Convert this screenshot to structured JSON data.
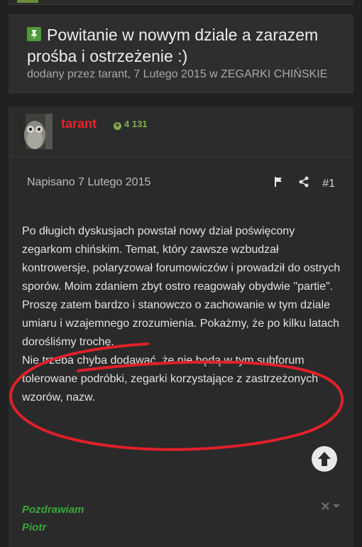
{
  "topic": {
    "title": "Powitanie w nowym dziale a zarazem prośba i ostrzeżenie :)",
    "byline": "dodany przez tarant, 7 Lutego 2015 w ZEGARKI CHIŃSKIE"
  },
  "post": {
    "author": "tarant",
    "reputation": "4 131",
    "date": "Napisano 7 Lutego 2015",
    "number": "#1",
    "paragraph1": "Po długich dyskusjach powstał nowy dział poświęcony zegarkom chińskim. Temat, który zawsze wzbudzał kontrowersje, polaryzował forumowiczów i prowadził do ostrych sporów. Moim zdaniem zbyt ostro reagowały obydwie \"partie\". Proszę zatem bardzo i stanowczo o zachowanie w tym dziale umiaru i wzajemnego zrozumienia. Pokażmy, że po kilku latach dorośliśmy trochę.",
    "paragraph2": "Nie trzeba chyba dodawać, że nie będą w tym subforum tolerowane podróbki, zegarki korzystające z zastrzeżonych wzorów, nazw.",
    "signature_line1": "Pozdrawiam",
    "signature_line2": "Piotr"
  },
  "icons": {
    "pin": "pushpin-icon",
    "flag": "flag-icon",
    "share": "share-icon",
    "scroll": "arrow-up-icon",
    "signature_toggle": "close-chevron-icon"
  },
  "colors": {
    "author": "#e8232a",
    "reputation": "#7fae4a",
    "signature": "#3aa63a",
    "annotation": "#e0202a"
  }
}
